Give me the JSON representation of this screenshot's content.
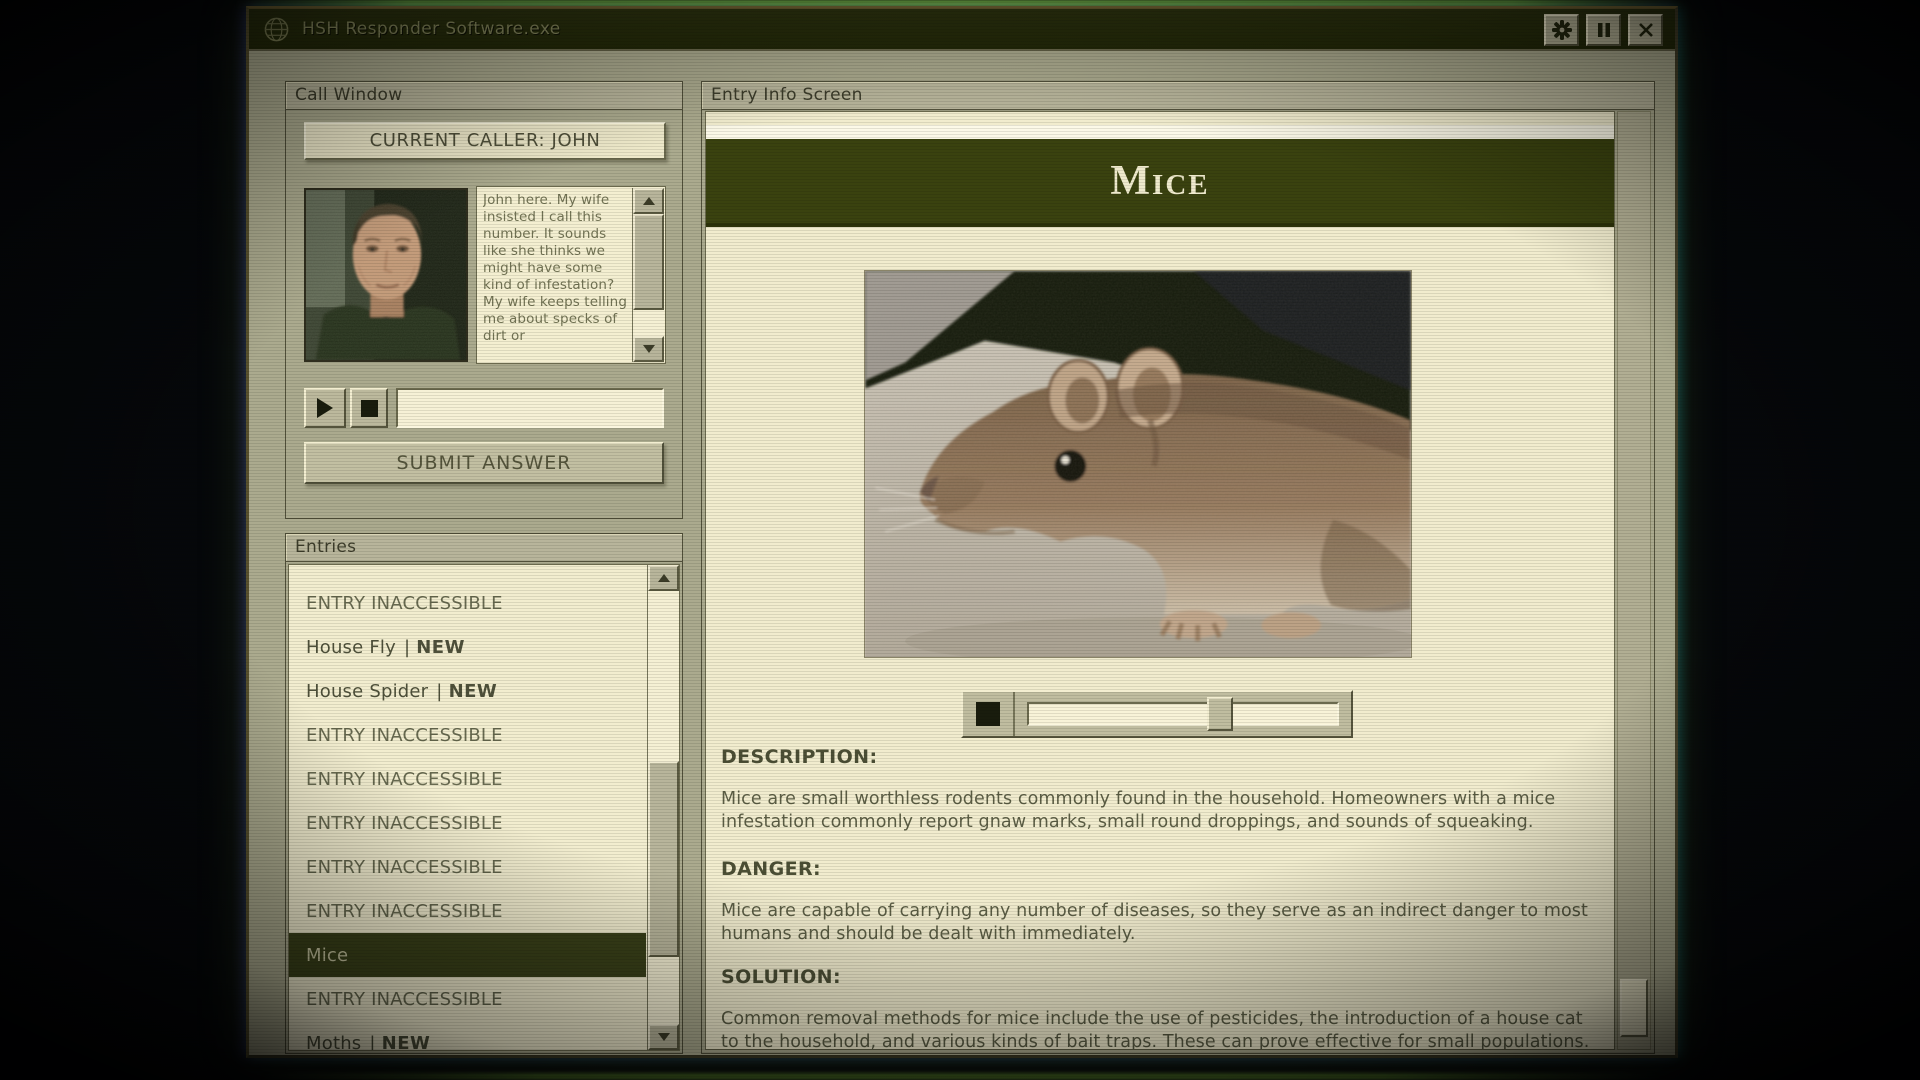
{
  "window": {
    "title": "HSH Responder Software.exe",
    "titlebar_icons": [
      "globe-icon",
      "gear-icon",
      "pause-icon",
      "close-icon"
    ]
  },
  "call_window": {
    "header": "Call Window",
    "current_caller_label": "CURRENT CALLER: JOHN",
    "transcript": "John here. My wife insisted I call this number. It sounds like she thinks we might have some kind of infestation? My wife keeps telling me about specks of dirt or",
    "answer_input": {
      "value": "",
      "placeholder": ""
    },
    "submit_label": "SUBMIT ANSWER",
    "media_icons": [
      "play-icon",
      "stop-icon"
    ]
  },
  "entries": {
    "header": "Entries",
    "separator": "|",
    "new_badge": "NEW",
    "items": [
      {
        "name": "ENTRY INACCESSIBLE",
        "accessible": false,
        "new": false,
        "selected": false
      },
      {
        "name": "House Fly",
        "accessible": true,
        "new": true,
        "selected": false
      },
      {
        "name": "House Spider",
        "accessible": true,
        "new": true,
        "selected": false
      },
      {
        "name": "ENTRY INACCESSIBLE",
        "accessible": false,
        "new": false,
        "selected": false
      },
      {
        "name": "ENTRY INACCESSIBLE",
        "accessible": false,
        "new": false,
        "selected": false
      },
      {
        "name": "ENTRY INACCESSIBLE",
        "accessible": false,
        "new": false,
        "selected": false
      },
      {
        "name": "ENTRY INACCESSIBLE",
        "accessible": false,
        "new": false,
        "selected": false
      },
      {
        "name": "ENTRY INACCESSIBLE",
        "accessible": false,
        "new": false,
        "selected": false
      },
      {
        "name": "Mice",
        "accessible": true,
        "new": false,
        "selected": true
      },
      {
        "name": "ENTRY INACCESSIBLE",
        "accessible": false,
        "new": false,
        "selected": false
      },
      {
        "name": "Moths",
        "accessible": true,
        "new": true,
        "selected": false
      }
    ]
  },
  "entry_info": {
    "header": "Entry Info Screen",
    "title": "Mice",
    "image": "mouse-photo",
    "audio_slider": {
      "position_pct": 62
    },
    "sections": [
      {
        "heading": "DESCRIPTION:",
        "body": "Mice are small worthless rodents commonly found in the household. Homeowners with a mice infestation commonly report gnaw marks, small round droppings, and sounds of squeaking."
      },
      {
        "heading": "DANGER:",
        "body": "Mice are capable of carrying any number of diseases, so they serve as an indirect danger to most humans and should be dealt with immediately."
      },
      {
        "heading": "SOLUTION:",
        "body": "Common removal methods for mice include the use of pesticides, the introduction of a house cat to the household, and various kinds of bait traps. These can prove effective for small populations. Large mice"
      }
    ]
  },
  "colors": {
    "titlebar": "#272d0e",
    "chrome": "#abaa8e",
    "panel_cream": "#f1ecce",
    "dark_olive_band": "#3a420f",
    "selected_row": "#3a4119",
    "crt_glow_green": "#6ca834"
  }
}
